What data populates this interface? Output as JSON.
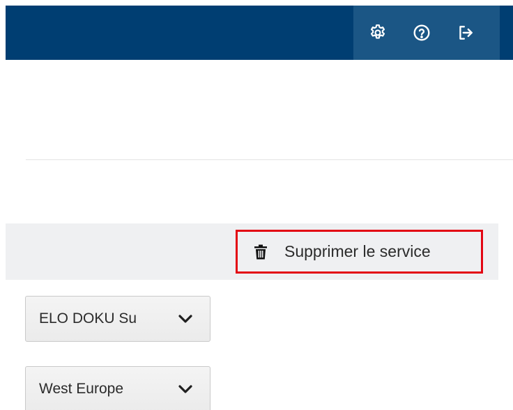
{
  "header": {
    "colors": {
      "bar": "#003e72",
      "actions_panel": "#1b5685"
    },
    "icons": [
      "gear-icon",
      "help-circle-icon",
      "logout-icon"
    ]
  },
  "toolbar": {
    "delete_service_label": "Supprimer le service",
    "delete_icon": "trash-icon",
    "highlight_color": "#e30613"
  },
  "form": {
    "service_select": {
      "value": "ELO DOKU Su"
    },
    "region_select": {
      "value": "West Europe"
    }
  }
}
